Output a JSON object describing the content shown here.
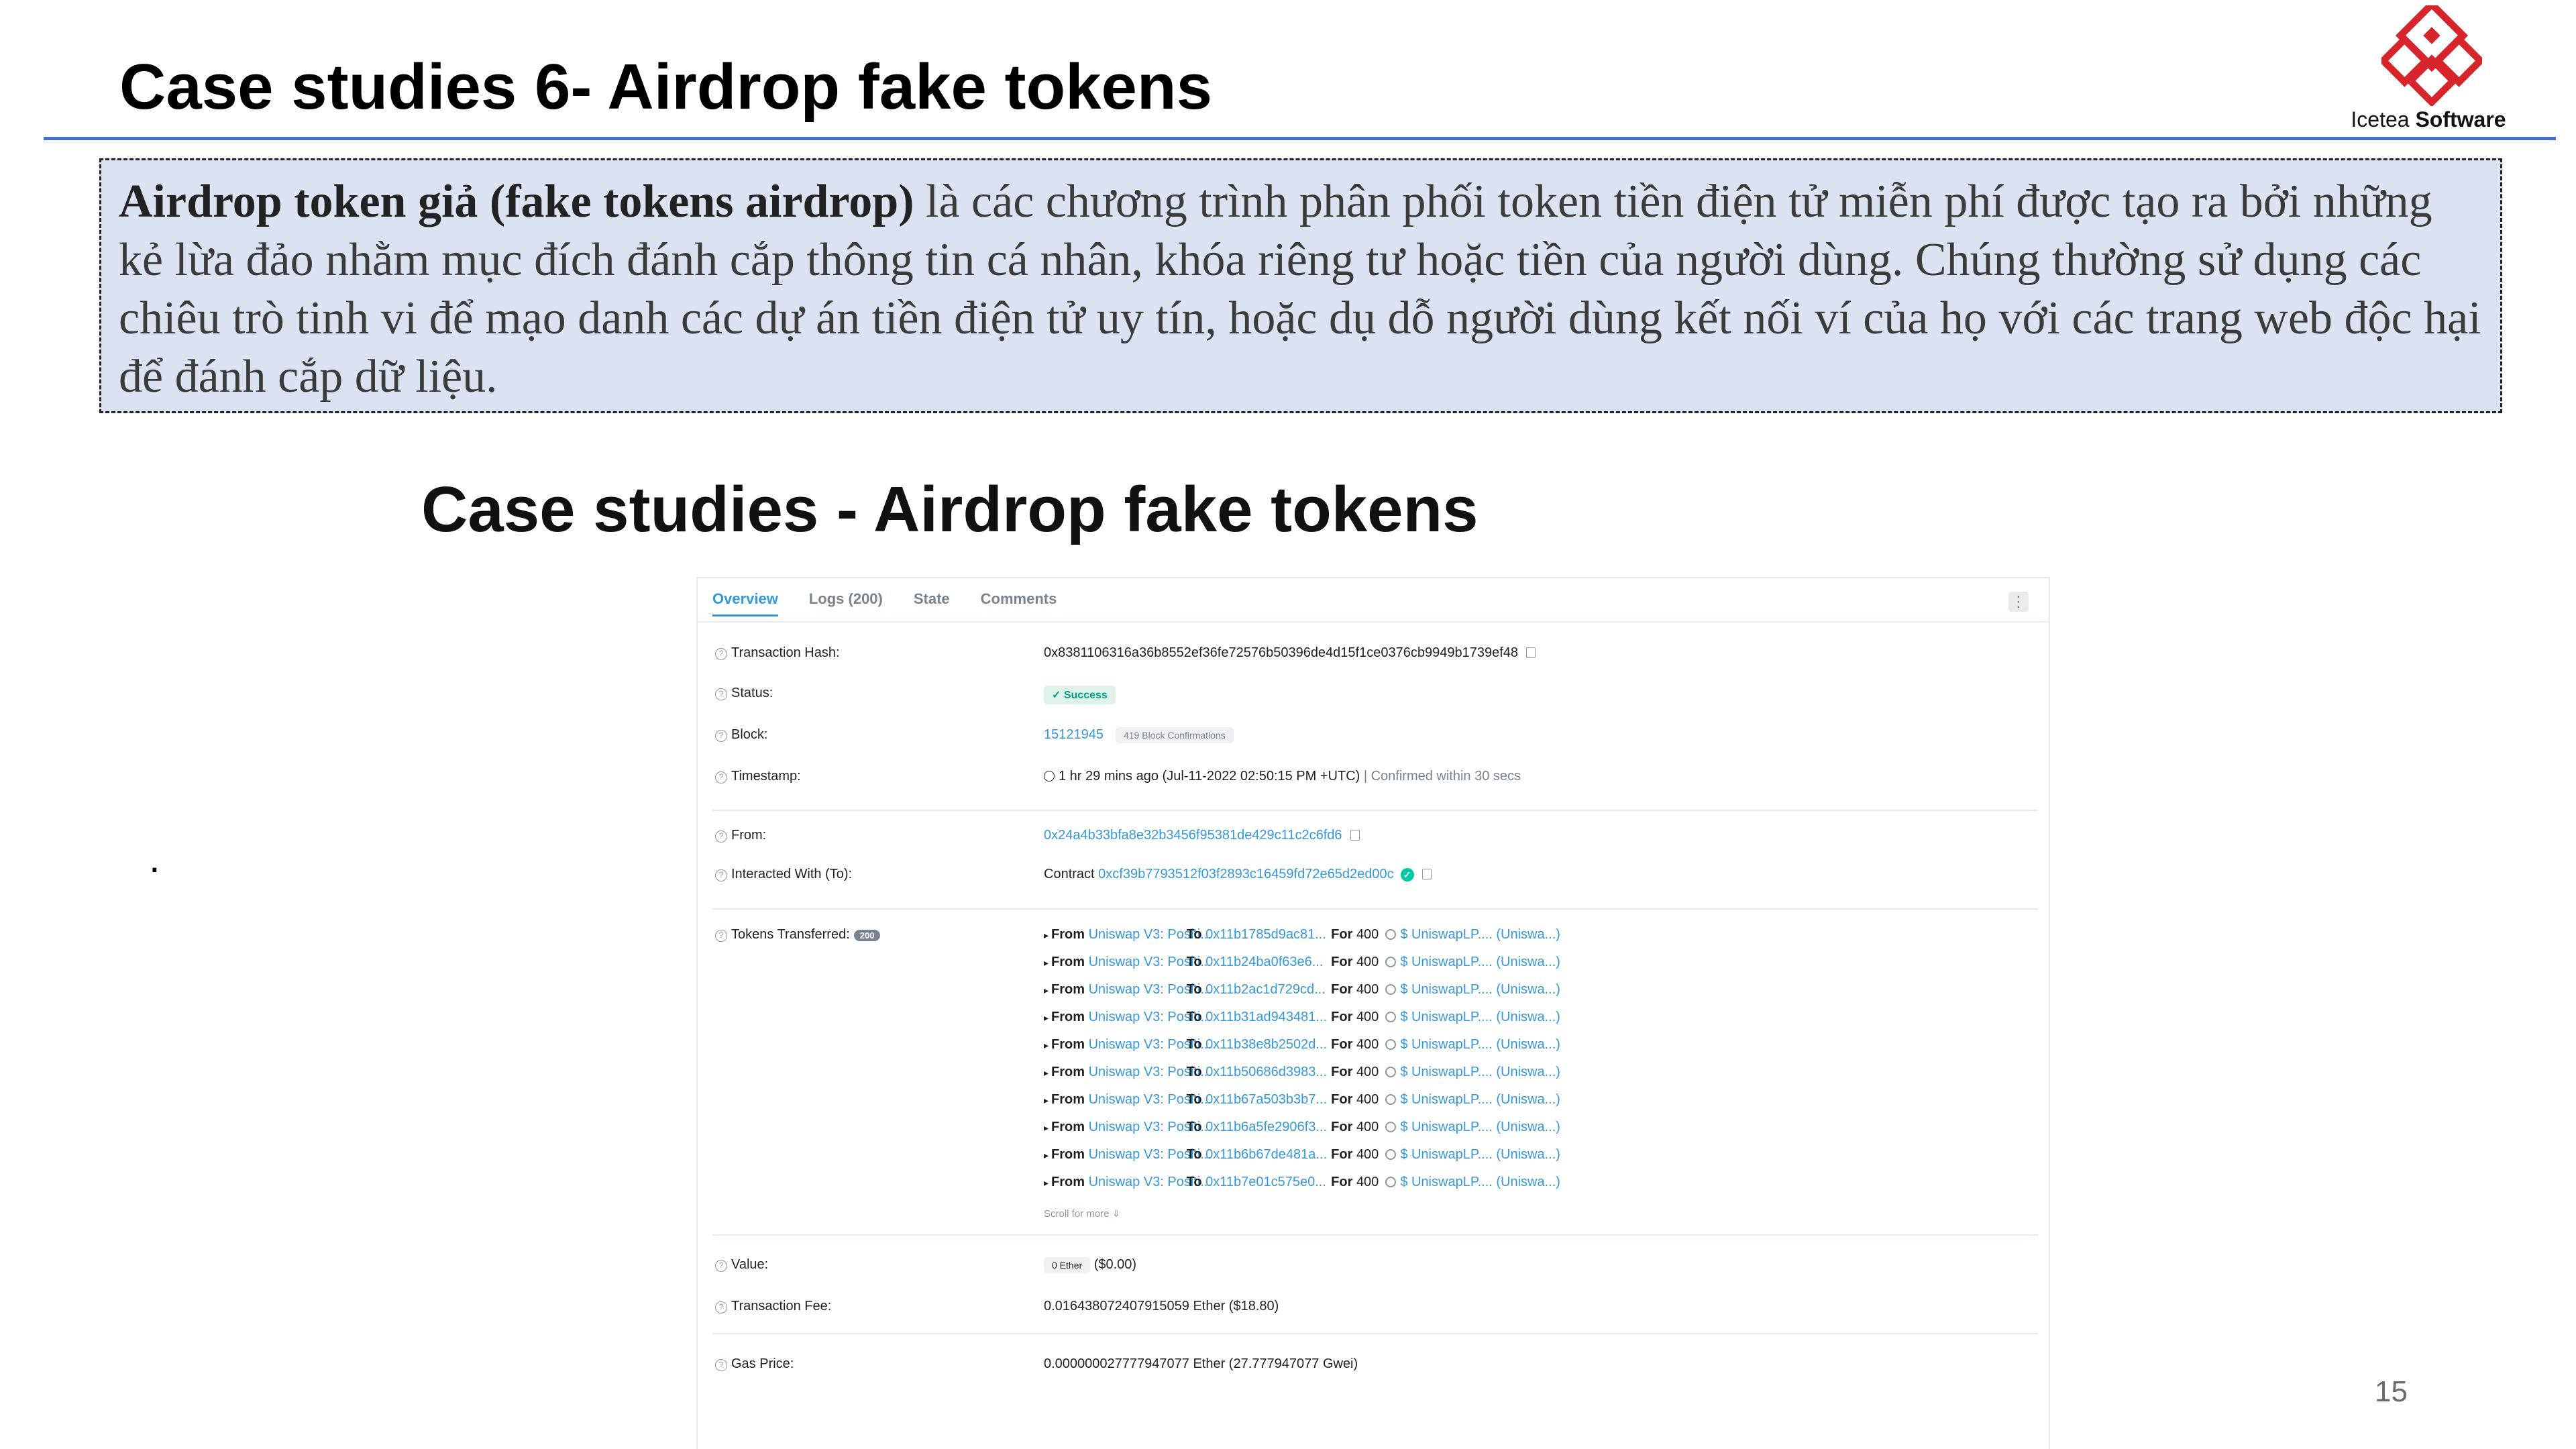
{
  "slide": {
    "title": "Case studies 6- Airdrop fake tokens",
    "subtitle": "Case studies - Airdrop fake tokens",
    "intro_bold": "Airdrop token giả (fake tokens airdrop)",
    "intro_rest": " là các chương trình phân phối token tiền điện tử miễn phí được tạo ra bởi những kẻ lừa đảo nhằm mục đích đánh cắp thông tin cá nhân, khóa riêng tư hoặc tiền của người dùng. Chúng thường sử dụng các chiêu trò tinh vi để mạo danh các dự án tiền điện tử uy tín, hoặc dụ dỗ người dùng kết nối ví của họ với các trang web độc hại để đánh cắp dữ liệu.",
    "bullet": ".",
    "page_number": "15"
  },
  "logo": {
    "name_light": "Icetea",
    "name_bold": "Software",
    "colors": {
      "mark": "#d8252c",
      "text": "#111111"
    }
  },
  "explorer": {
    "tabs": [
      "Overview",
      "Logs (200)",
      "State",
      "Comments"
    ],
    "more_button": "⋮",
    "fields": {
      "tx_hash_label": "Transaction Hash:",
      "tx_hash": "0x8381106316a36b8552ef36fe72576b50396de4d15f1ce0376cb9949b1739ef48",
      "status_label": "Status:",
      "status": "Success",
      "block_label": "Block:",
      "block": "15121945",
      "confirmations": "419 Block Confirmations",
      "timestamp_label": "Timestamp:",
      "timestamp": "1 hr 29 mins ago (Jul-11-2022 02:50:15 PM +UTC)",
      "confirmed": "Confirmed within 30 secs",
      "from_label": "From:",
      "from": "0x24a4b33bfa8e32b3456f95381de429c11c2c6fd6",
      "to_label": "Interacted With (To):",
      "contract_prefix": "Contract",
      "contract": "0xcf39b7793512f03f2893c16459fd72e65d2ed00c",
      "tokens_label": "Tokens Transferred:",
      "tokens_count": "200",
      "scroll_more": "Scroll for more ⇓",
      "value_label": "Value:",
      "value_ether": "0 Ether",
      "value_usd": "($0.00)",
      "fee_label": "Transaction Fee:",
      "fee": "0.016438072407915059 Ether ($18.80)",
      "gas_label": "Gas Price:",
      "gas": "0.000000027777947077 Ether (27.777947077 Gwei)"
    },
    "transfer_words": {
      "from": "From",
      "to": "To",
      "for": "For"
    },
    "transfers": [
      {
        "from": "Uniswap V3: Positi...",
        "to": "0x11b1785d9ac81...",
        "amount": "400",
        "token": "$ UniswapLP.... (Uniswa...)"
      },
      {
        "from": "Uniswap V3: Positi...",
        "to": "0x11b24ba0f63e6...",
        "amount": "400",
        "token": "$ UniswapLP.... (Uniswa...)"
      },
      {
        "from": "Uniswap V3: Positi...",
        "to": "0x11b2ac1d729cd...",
        "amount": "400",
        "token": "$ UniswapLP.... (Uniswa...)"
      },
      {
        "from": "Uniswap V3: Positi...",
        "to": "0x11b31ad943481...",
        "amount": "400",
        "token": "$ UniswapLP.... (Uniswa...)"
      },
      {
        "from": "Uniswap V3: Positi...",
        "to": "0x11b38e8b2502d...",
        "amount": "400",
        "token": "$ UniswapLP.... (Uniswa...)"
      },
      {
        "from": "Uniswap V3: Positi...",
        "to": "0x11b50686d3983...",
        "amount": "400",
        "token": "$ UniswapLP.... (Uniswa...)"
      },
      {
        "from": "Uniswap V3: Positi...",
        "to": "0x11b67a503b3b7...",
        "amount": "400",
        "token": "$ UniswapLP.... (Uniswa...)"
      },
      {
        "from": "Uniswap V3: Positi...",
        "to": "0x11b6a5fe2906f3...",
        "amount": "400",
        "token": "$ UniswapLP.... (Uniswa...)"
      },
      {
        "from": "Uniswap V3: Positi...",
        "to": "0x11b6b67de481a...",
        "amount": "400",
        "token": "$ UniswapLP.... (Uniswa...)"
      },
      {
        "from": "Uniswap V3: Positi...",
        "to": "0x11b7e01c575e0...",
        "amount": "400",
        "token": "$ UniswapLP.... (Uniswa...)"
      }
    ]
  }
}
